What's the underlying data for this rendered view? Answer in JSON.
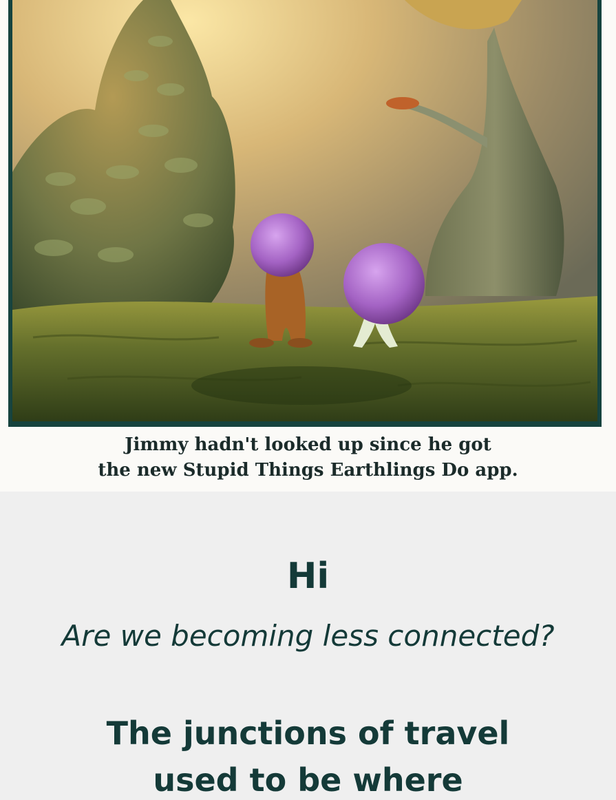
{
  "illustration": {
    "icon": "alien-creatures-illustration",
    "colors": {
      "frame": "#16433e",
      "sky_glow": "#f5d98a",
      "ground": "#5b6a2a",
      "alien_head": "#a668c4",
      "alien_body": "#b06a2a"
    }
  },
  "caption": {
    "line1": "Jimmy hadn't looked up since he got",
    "line2": "the new Stupid Things Earthlings Do app."
  },
  "post": {
    "greeting": "Hi",
    "question": "Are we becoming less connected?",
    "line1": "The junctions of travel",
    "line2": "used to be where"
  }
}
